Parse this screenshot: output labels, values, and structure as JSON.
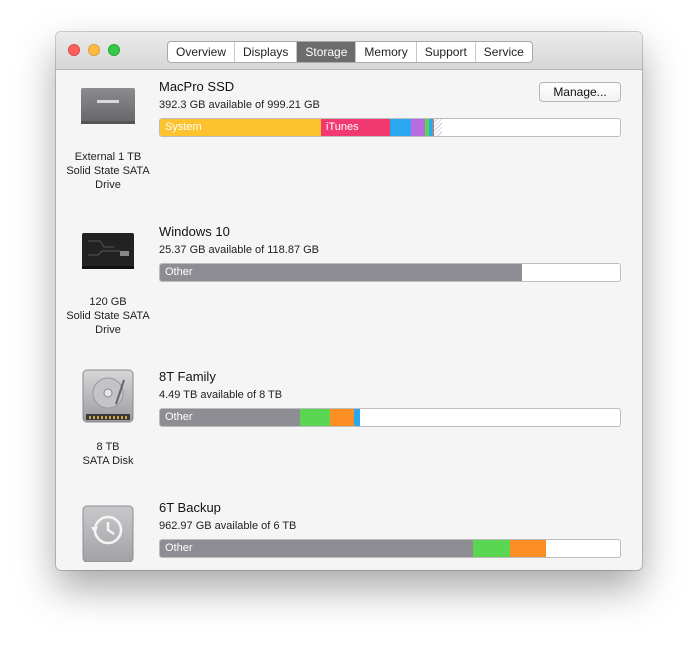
{
  "tabs": [
    {
      "label": "Overview"
    },
    {
      "label": "Displays"
    },
    {
      "label": "Storage",
      "active": true
    },
    {
      "label": "Memory"
    },
    {
      "label": "Support"
    },
    {
      "label": "Service"
    }
  ],
  "colors": {
    "system": "#fdc22d",
    "itunes": "#f23871",
    "blue": "#2aa8ef",
    "purple": "#b86ae0",
    "green": "#5ad653",
    "orange": "#fb8f24",
    "other": "#8e8d94"
  },
  "drives": [
    {
      "name": "MacPro SSD",
      "available": "392.3 GB available of 999.21 GB",
      "caption": [
        "External 1 TB",
        "Solid State SATA",
        "Drive"
      ],
      "icon": "ssd-samsung-icon",
      "manage_label": "Manage...",
      "segments": [
        {
          "label": "System",
          "fraction": 0.35,
          "color": "#fdc22d"
        },
        {
          "label": "iTunes",
          "fraction": 0.151,
          "color": "#f23871"
        },
        {
          "label": "",
          "fraction": 0.045,
          "color": "#2aa8ef"
        },
        {
          "label": "",
          "fraction": 0.03,
          "color": "#b86ae0"
        },
        {
          "label": "",
          "fraction": 0.009,
          "color": "#5ad653"
        },
        {
          "label": "",
          "fraction": 0.006,
          "color": "#2aa8ef"
        },
        {
          "label": "",
          "fraction": 0.005,
          "color": "#8e8d94"
        },
        {
          "label": "",
          "fraction": 0.017,
          "color": "hatch"
        }
      ]
    },
    {
      "name": "Windows 10",
      "available": "25.37 GB available of 118.87 GB",
      "caption": [
        "120 GB",
        "Solid State SATA",
        "Drive"
      ],
      "icon": "ssd-black-icon",
      "segments": [
        {
          "label": "Other",
          "fraction": 0.786,
          "color": "#8e8d94"
        }
      ]
    },
    {
      "name": "8T Family",
      "available": "4.49 TB available of 8 TB",
      "caption": [
        "8 TB",
        "SATA Disk"
      ],
      "icon": "hard-disk-icon",
      "segments": [
        {
          "label": "Other",
          "fraction": 0.305,
          "color": "#8e8d94"
        },
        {
          "label": "",
          "fraction": 0.065,
          "color": "#5ad653"
        },
        {
          "label": "",
          "fraction": 0.053,
          "color": "#fb8f24"
        },
        {
          "label": "",
          "fraction": 0.012,
          "color": "#2aa8ef"
        }
      ]
    },
    {
      "name": "6T Backup",
      "available": "962.97 GB available of 6 TB",
      "caption": [],
      "icon": "time-machine-disk-icon",
      "segments": [
        {
          "label": "Other",
          "fraction": 0.68,
          "color": "#8e8d94"
        },
        {
          "label": "",
          "fraction": 0.08,
          "color": "#5ad653"
        },
        {
          "label": "",
          "fraction": 0.078,
          "color": "#fb8f24"
        }
      ]
    }
  ]
}
